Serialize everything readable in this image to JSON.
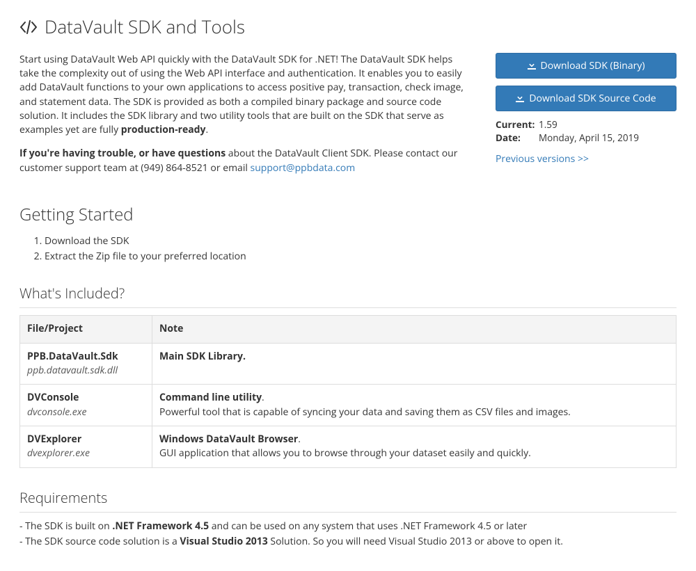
{
  "title": "DataVault SDK and Tools",
  "intro": {
    "p1_a": "Start using DataVault Web API quickly with the DataVault SDK for .NET! The DataVault SDK helps take the complexity out of using the Web API interface and authentication. It enables you to easily add DataVault functions to your own applications to access positive pay, transaction, check image, and statement data. The SDK is provided as both a compiled binary package and source code solution. It includes the SDK library and two utility tools that are built on the SDK that serve as examples yet are fully ",
    "p1_bold": "production-ready",
    "p1_b": ".",
    "p2_bold": "If you're having trouble, or have questions",
    "p2_a": " about the DataVault Client SDK. Please contact our customer support team at (949) 864-8521 or email ",
    "p2_link": "support@ppbdata.com"
  },
  "buttons": {
    "binary": "Download SDK (Binary)",
    "source": "Download SDK Source Code"
  },
  "info": {
    "current_label": "Current:",
    "current_value": "1.59",
    "date_label": "Date:",
    "date_value": "Monday, April 15, 2019",
    "prev_link": "Previous versions >>"
  },
  "getting_started": {
    "heading": "Getting Started",
    "steps": [
      "Download the SDK",
      "Extract the Zip file to your preferred location"
    ]
  },
  "included": {
    "heading": "What's Included?",
    "col1": "File/Project",
    "col2": "Note",
    "rows": [
      {
        "name": "PPB.DataVault.Sdk",
        "file": "ppb.datavault.sdk.dll",
        "note_head": "Main SDK Library.",
        "note_body": ""
      },
      {
        "name": "DVConsole",
        "file": "dvconsole.exe",
        "note_head": "Command line utility",
        "note_sep": ".",
        "note_body": "Powerful tool that is capable of syncing your data and saving them as CSV files and images."
      },
      {
        "name": "DVExplorer",
        "file": "dvexplorer.exe",
        "note_head": "Windows DataVault Browser",
        "note_sep": ".",
        "note_body": "GUI application that allows you to browse through your dataset easily and quickly."
      }
    ]
  },
  "requirements": {
    "heading": "Requirements",
    "r1_a": "- The SDK is built on ",
    "r1_bold": ".NET Framework 4.5",
    "r1_b": " and can be used on any system that uses .NET Framework 4.5 or later",
    "r2_a": "- The SDK source code solution is a ",
    "r2_bold": "Visual Studio 2013",
    "r2_b": " Solution. So you will need Visual Studio 2013 or above to open it."
  }
}
